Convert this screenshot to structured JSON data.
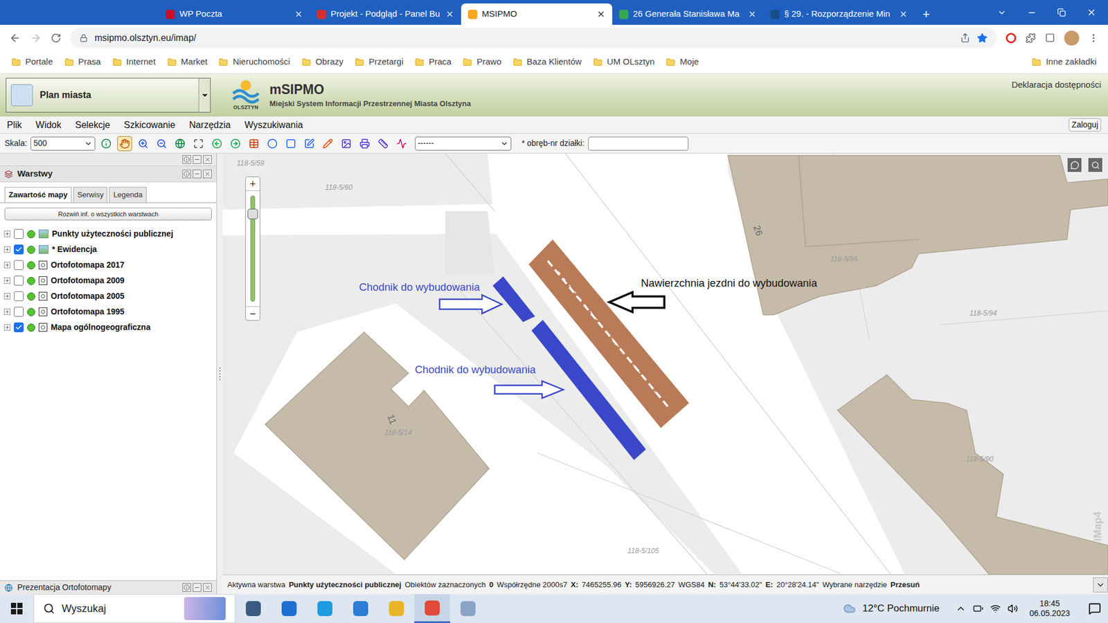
{
  "browser": {
    "tabs": [
      {
        "label": "WP Poczta",
        "selected": false,
        "color": "#c8102e"
      },
      {
        "label": "Projekt - Podgląd - Panel Bu",
        "selected": false,
        "color": "#d32f2f"
      },
      {
        "label": "MSIPMO",
        "selected": true,
        "color": "#f5a623"
      },
      {
        "label": "26 Generała Stanisława Ma",
        "selected": false,
        "color": "#34a853"
      },
      {
        "label": "§ 29. - Rozporządzenie Min",
        "selected": false,
        "color": "#1a4e8a"
      }
    ],
    "new_tab": "+",
    "url": "msipmo.olsztyn.eu/imap/",
    "bookmarks": [
      "Portale",
      "Prasa",
      "Internet",
      "Market",
      "Nieruchomości",
      "Obrazy",
      "Przetargi",
      "Praca",
      "Prawo",
      "Baza Klientów",
      "UM OLsztyn",
      "Moje"
    ],
    "other_bookmarks": "Inne zakładki"
  },
  "app_header": {
    "view_select": "Plan miasta",
    "logo_caption": "OLSZTYN",
    "title": "mSIPMO",
    "subtitle": "Miejski System Informacji Przestrzennej Miasta Olsztyna",
    "accessibility": "Deklaracja dostępności"
  },
  "menu": [
    "Plik",
    "Widok",
    "Selekcje",
    "Szkicowanie",
    "Narzędzia",
    "Wyszukiwania"
  ],
  "login": "Zaloguj",
  "toolbar": {
    "scale_label": "Skala:",
    "scale_value": "500",
    "tools": [
      {
        "selected": false
      },
      {
        "selected": true
      },
      {
        "selected": false
      },
      {
        "selected": false
      },
      {
        "selected": false
      },
      {
        "selected": false
      },
      {
        "selected": false
      },
      {
        "selected": false
      },
      {
        "selected": false
      },
      {
        "selected": false
      },
      {
        "selected": false
      },
      {
        "selected": false
      },
      {
        "selected": false
      },
      {
        "selected": false
      },
      {
        "selected": false
      },
      {
        "selected": false
      },
      {
        "selected": false
      }
    ],
    "layer_select": "------",
    "parcel_label": "* obręb-nr działki:",
    "parcel_value": ""
  },
  "layers_panel": {
    "title": "Warstwy",
    "tabs": [
      {
        "label": "Zawartość mapy",
        "selected": true
      },
      {
        "label": "Serwisy",
        "selected": false
      },
      {
        "label": "Legenda",
        "selected": false
      }
    ],
    "expand_button": "Rozwiń inf. o wszystkich warstwach",
    "layers": [
      {
        "name": "Punkty użyteczności publicznej",
        "checked": false,
        "kind": "group"
      },
      {
        "name": "* Ewidencja",
        "checked": true,
        "kind": "group"
      },
      {
        "name": "Ortofotomapa 2017",
        "checked": false,
        "kind": "service"
      },
      {
        "name": "Ortofotomapa 2009",
        "checked": false,
        "kind": "service"
      },
      {
        "name": "Ortofotomapa 2005",
        "checked": false,
        "kind": "service"
      },
      {
        "name": "Ortofotomapa 1995",
        "checked": false,
        "kind": "service"
      },
      {
        "name": "Mapa ogólnogeograficzna",
        "checked": true,
        "kind": "service"
      }
    ],
    "bottom_panel": "Prezentacja Ortofotomapy"
  },
  "map": {
    "zoom_in": "+",
    "zoom_out": "−",
    "zoom_level": 0.88,
    "parcels": [
      "118-5/59",
      "118-5/60",
      "118-5/96",
      "118-5/94",
      "118-5/14",
      "118-5/90",
      "118-5/105"
    ],
    "building_numbers": [
      "26",
      "11"
    ],
    "annotations": [
      {
        "text": "Chodnik do wybudowania",
        "color": "#3b47c9"
      },
      {
        "text": "Chodnik do wybudowania",
        "color": "#3b47c9"
      },
      {
        "text": "Nawierzchnia jezdni do wybudowania",
        "color": "#111111"
      }
    ],
    "watermark": "iMap4"
  },
  "status_bar": [
    {
      "text": "Aktywna warstwa",
      "bold": false
    },
    {
      "text": "Punkty użyteczności publicznej",
      "bold": true
    },
    {
      "text": "Obiektów zaznaczonych",
      "bold": false
    },
    {
      "text": "0",
      "bold": true
    },
    {
      "text": "Współrzędne 2000s7",
      "bold": false
    },
    {
      "text": "X:",
      "bold": true
    },
    {
      "text": "7465255.96",
      "bold": false
    },
    {
      "text": "Y:",
      "bold": true
    },
    {
      "text": "5956926.27",
      "bold": false
    },
    {
      "text": "WGS84",
      "bold": false
    },
    {
      "text": "N:",
      "bold": true
    },
    {
      "text": "53°44'33.02\"",
      "bold": false
    },
    {
      "text": "E:",
      "bold": true
    },
    {
      "text": "20°28'24.14\"",
      "bold": false
    },
    {
      "text": "Wybrane narzędzie",
      "bold": false
    },
    {
      "text": "Przesuń",
      "bold": true
    }
  ],
  "taskbar": {
    "search": "Wyszukaj",
    "weather": "12°C Pochmurnie",
    "time": "18:45",
    "date": "06.05.2023"
  }
}
